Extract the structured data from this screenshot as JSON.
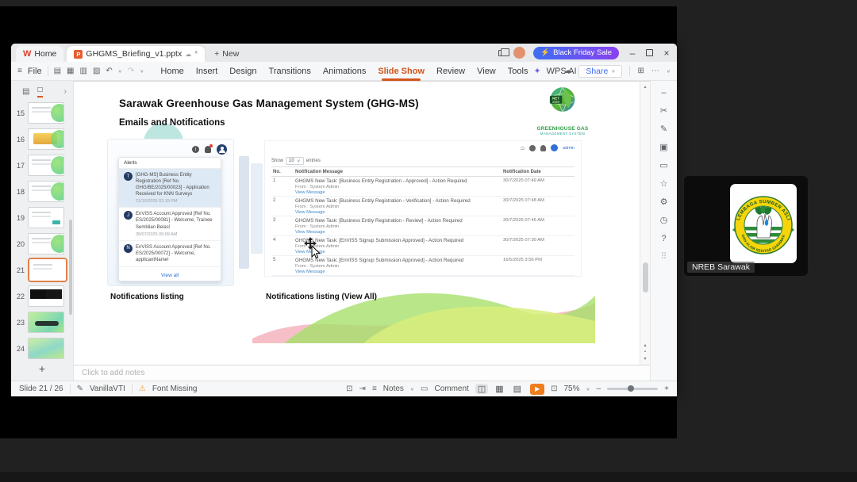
{
  "meeting": {
    "participant_name": "NREB Sarawak",
    "logo_arc_top": "LEMBAGA SUMBER ASLI",
    "logo_arc_bottom": "DAN ALAM SEKITAR SARAWAK"
  },
  "window": {
    "titlebar": {
      "home_tab": "Home",
      "doc_tab": "GHGMS_Briefing_v1.pptx",
      "modified": "*",
      "new_tab": "New",
      "promo": "Black Friday Sale"
    },
    "menubar": {
      "file": "File",
      "items": [
        "Home",
        "Insert",
        "Design",
        "Transitions",
        "Animations",
        "Slide Show",
        "Review",
        "View",
        "Tools"
      ],
      "wps_ai": "WPS AI",
      "share": "Share"
    }
  },
  "slide_panel": {
    "slides": [
      {
        "num": "15"
      },
      {
        "num": "16"
      },
      {
        "num": "17"
      },
      {
        "num": "18"
      },
      {
        "num": "19"
      },
      {
        "num": "20"
      },
      {
        "num": "21"
      },
      {
        "num": "22"
      },
      {
        "num": "23"
      },
      {
        "num": "24"
      }
    ],
    "add": "+"
  },
  "slide": {
    "title": "Sarawak Greenhouse Gas Management System (GHG-MS)",
    "subtitle": "Emails and Notifications",
    "logo": {
      "badge_top": "NET",
      "badge_year": "2050",
      "name": "GREENHOUSE GAS",
      "tagline": "MANAGEMENT SYSTEM"
    },
    "caption_left": "Notifications listing",
    "caption_right": "Notifications listing (View All)",
    "alerts": {
      "header": "Alerts",
      "items": [
        {
          "avatar": "T",
          "text": "[GHG-MS] Business Entity Registration [Ref No. GHG/BE/2025/00023] - Application Received for KNN Surveys",
          "time": "21/10/2025 02:19 PM"
        },
        {
          "avatar": "J",
          "text": "EnVISS Account Approved [Ref No. ES/2025/00081] - Welcome, Trainee Sembilan Belas!",
          "time": "30/07/2025 09:09 AM"
        },
        {
          "avatar": "N",
          "text": "EnVISS Account Approved [Ref No. ES/2025/00072] - Welcome, applicantName!",
          "time": ""
        }
      ],
      "view_all": "View all"
    },
    "listing": {
      "user": "admin",
      "show": "Show",
      "page_size": "10",
      "entries": "entries",
      "col_no": "No.",
      "col_message": "Notification Message",
      "col_date": "Notification Date",
      "from": "From : System Admin",
      "link": "View Message",
      "rows": [
        {
          "no": "1",
          "message": "GHGMS New Task: [Business Entity Registration - Approved] - Action Required",
          "date": "30/7/2025 07:49 AM"
        },
        {
          "no": "2",
          "message": "GHGMS New Task: [Business Entity Registration - Verification] - Action Required",
          "date": "30/7/2025 07:48 AM"
        },
        {
          "no": "3",
          "message": "GHGMS New Task: [Business Entity Registration - Review] - Action Required",
          "date": "30/7/2025 07:46 AM"
        },
        {
          "no": "4",
          "message": "GHGMS New Task: [EnVISS Signup Submission Approved] - Action Required",
          "date": "30/7/2025 07:30 AM"
        },
        {
          "no": "5",
          "message": "GHGMS New Task: [EnVISS Signup Submission Approved] - Action Required",
          "date": "16/5/2025 3:56 PM"
        }
      ]
    }
  },
  "notes": {
    "placeholder": "Click to add notes"
  },
  "statusbar": {
    "slide_info": "Slide 21 / 26",
    "theme": "VanillaVTI",
    "font_missing": "Font Missing",
    "notes": "Notes",
    "comment": "Comment",
    "zoom": "75%"
  },
  "icons": {
    "hamburger": "≡",
    "save": "▤",
    "print": "▥",
    "export": "▦",
    "scan": "▧",
    "undo": "↶",
    "redo": "↷",
    "caret_down": "∨",
    "cloud": "☁",
    "more": "⋯",
    "panel_grid": "⊞",
    "star": "☆",
    "scissors": "✂",
    "pencil": "✎",
    "panel_box": "▣",
    "comment_box": "▭",
    "gear": "⚙",
    "clock": "◷",
    "help": "?",
    "apps": "⠿",
    "minus": "–",
    "plus": "+",
    "close": "×",
    "chevron_right": "›",
    "home": "⌂",
    "warning": "⚠",
    "play": "▶",
    "sparkle": "✦",
    "bolt": "⚡",
    "fit": "⊡",
    "view_normal": "◫",
    "view_sorter": "▦",
    "view_read": "▤",
    "outline": "▤",
    "slide_box": "□",
    "up": "▴",
    "down": "▾",
    "dot": "▪",
    "pen_mode": "⇥",
    "desk_mode": "⊡",
    "notes_lines": "≡"
  }
}
